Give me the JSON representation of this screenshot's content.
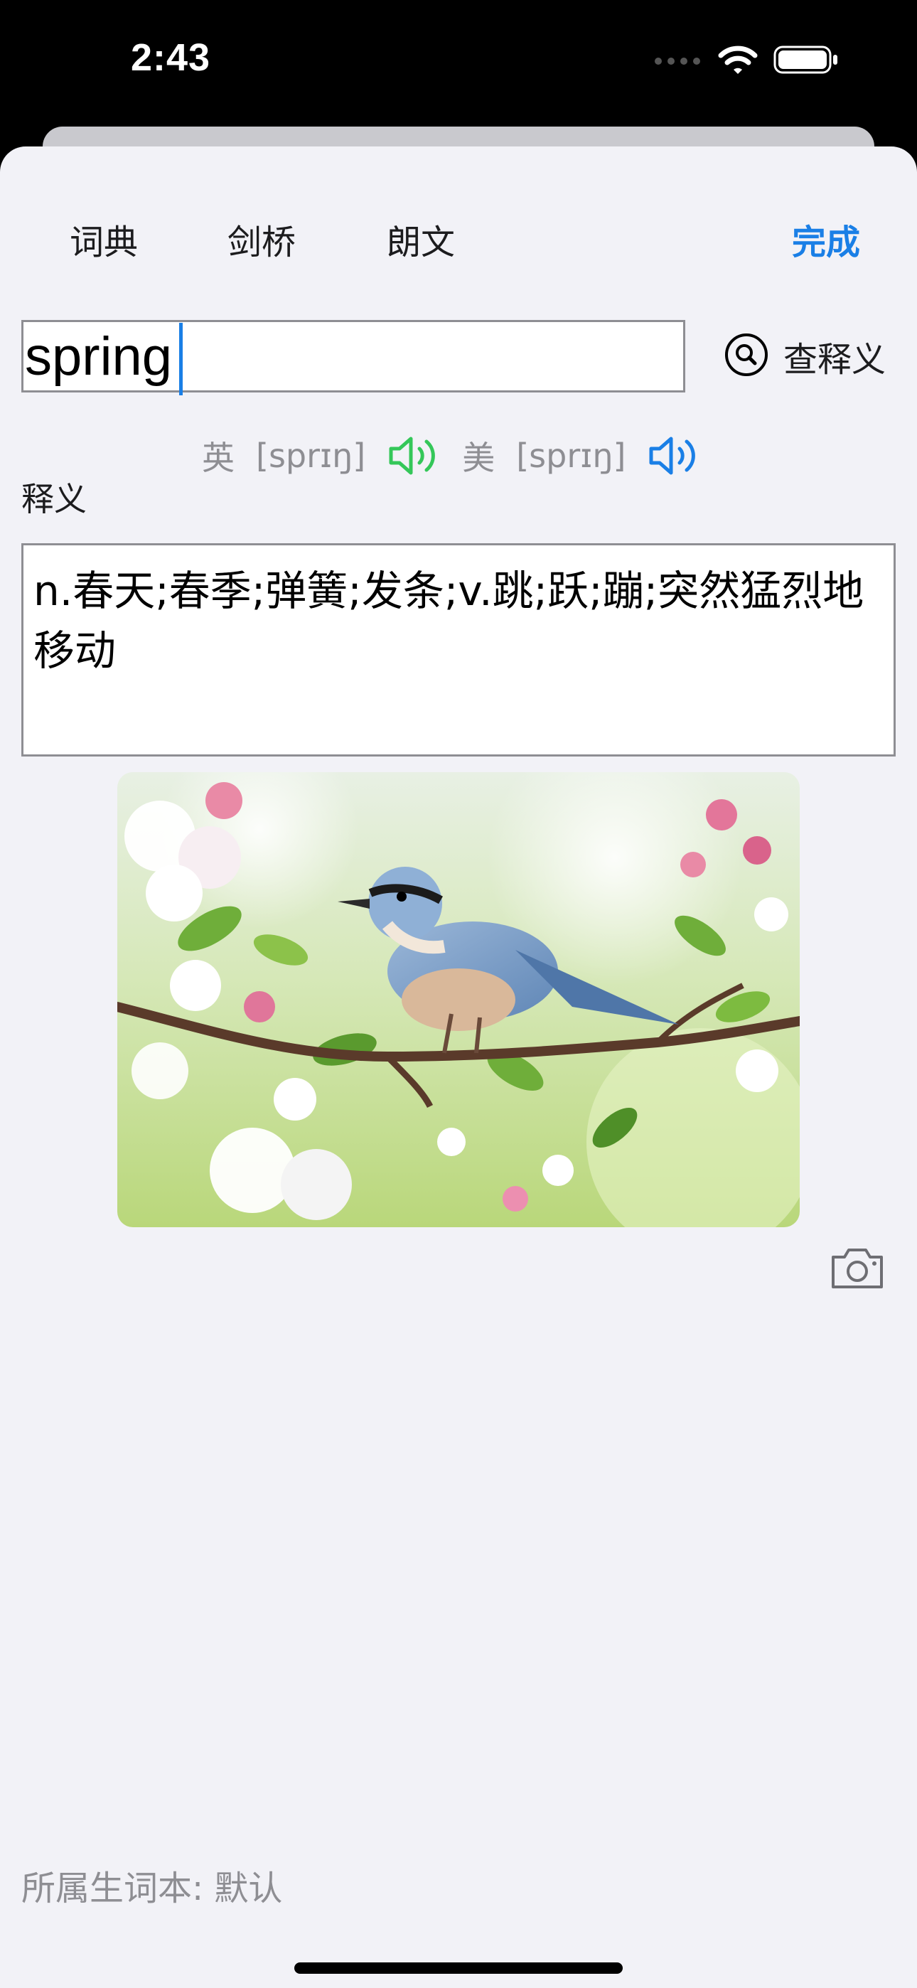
{
  "status_bar": {
    "time": "2:43"
  },
  "nav": {
    "tabs": [
      {
        "label": "词典"
      },
      {
        "label": "剑桥"
      },
      {
        "label": "朗文"
      }
    ],
    "done_label": "完成"
  },
  "search": {
    "value": "spring",
    "lookup_label": "查释义",
    "lookup_icon": "magnifier-circle-icon"
  },
  "pronunciation": {
    "uk": {
      "label": "英",
      "ipa": "[sprɪŋ]",
      "icon": "speaker-icon",
      "color": "#34c759"
    },
    "us": {
      "label": "美",
      "ipa": "[sprɪŋ]",
      "icon": "speaker-icon",
      "color": "#1a7fe6"
    }
  },
  "definition": {
    "label": "释义",
    "text": "n.春天;春季;弹簧;发条;v.跳;跃;蹦;突然猛烈地移动"
  },
  "image": {
    "icon": "camera-icon"
  },
  "vocab_book": {
    "text": "所属生词本: 默认"
  },
  "colors": {
    "accent": "#1a7fe6",
    "background": "#f2f2f7"
  }
}
